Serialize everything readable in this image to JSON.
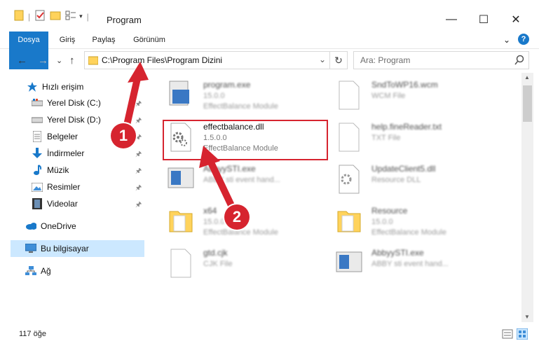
{
  "window": {
    "title": "Program",
    "minimize": "—",
    "maximize": "☐",
    "close": "✕"
  },
  "ribbon": {
    "tabs": [
      "Dosya",
      "Giriş",
      "Paylaş",
      "Görünüm"
    ],
    "expand": "⌄",
    "help": "?"
  },
  "nav": {
    "back": "←",
    "forward": "→",
    "recent": "⌄",
    "up": "↑",
    "address": "C:\\Program Files\\Program Dizini",
    "address_dropdown": "⌄",
    "refresh": "↻",
    "search_placeholder": "Ara: Program"
  },
  "sidebar": {
    "items": [
      {
        "label": "Hızlı erişim",
        "icon": "star-icon",
        "pinned": false
      },
      {
        "label": "Yerel Disk (C:)",
        "icon": "drive-icon",
        "pinned": true
      },
      {
        "label": "Yerel Disk (D:)",
        "icon": "drive-icon",
        "pinned": true
      },
      {
        "label": "Belgeler",
        "icon": "document-icon",
        "pinned": true
      },
      {
        "label": "İndirmeler",
        "icon": "download-icon",
        "pinned": true
      },
      {
        "label": "Müzik",
        "icon": "music-icon",
        "pinned": true
      },
      {
        "label": "Resimler",
        "icon": "pictures-icon",
        "pinned": true
      },
      {
        "label": "Videolar",
        "icon": "video-icon",
        "pinned": true
      },
      {
        "label": "OneDrive",
        "icon": "cloud-icon",
        "pinned": false
      },
      {
        "label": "Bu bilgisayar",
        "icon": "computer-icon",
        "pinned": false
      },
      {
        "label": "Ağ",
        "icon": "network-icon",
        "pinned": false
      }
    ],
    "pin_glyph": "📌",
    "selected": "Bu bilgisayar"
  },
  "files": [
    {
      "name": "program.exe",
      "line1": "15.0.0",
      "line2": "EffectBalance Module",
      "icon": "exe-icon"
    },
    {
      "name": "SndToWP16.wcm",
      "line1": "WCM File",
      "line2": "",
      "icon": "blank-file-icon"
    },
    {
      "name": "effectbalance.dll",
      "line1": "1.5.0.0",
      "line2": "EffectBalance Module",
      "icon": "dll-gear-icon"
    },
    {
      "name": "help.fineReader.txt",
      "line1": "TXT File",
      "line2": "",
      "icon": "blank-file-icon"
    },
    {
      "name": "AbbyySTI.exe",
      "line1": "ABBY sti event hand...",
      "line2": "",
      "icon": "exe-icon"
    },
    {
      "name": "UpdateClient5.dll",
      "line1": "Resource DLL",
      "line2": "",
      "icon": "dll-gear-icon"
    },
    {
      "name": "x64",
      "line1": "15.0.0",
      "line2": "EffectBalance Module",
      "icon": "folder-icon"
    },
    {
      "name": "Resource",
      "line1": "15.0.0",
      "line2": "EffectBalance Module",
      "icon": "folder-icon"
    },
    {
      "name": "gtd.cjk",
      "line1": "CJK File",
      "line2": "",
      "icon": "blank-file-icon"
    },
    {
      "name": "AbbyySTI.exe",
      "line1": "ABBY sti event hand...",
      "line2": "",
      "icon": "exe-icon"
    }
  ],
  "status": {
    "count": "117 öğe"
  },
  "annotations": {
    "step1": "1",
    "step2": "2",
    "accent": "#d6242f"
  },
  "colors": {
    "file_tab": "#1979ca",
    "selection": "#cce8ff"
  }
}
